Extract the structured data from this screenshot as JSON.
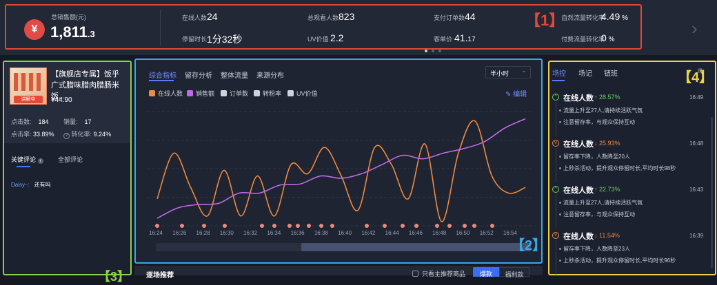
{
  "stats": {
    "sales_icon": "¥",
    "sales_label": "总销售额(元)",
    "sales_value": "1,811",
    "sales_decimal": ".3",
    "items": [
      {
        "label": "在线人数",
        "value": "24",
        "suffix": ""
      },
      {
        "label": "总观看人数",
        "value": "823",
        "suffix": ""
      },
      {
        "label": "支付订单数",
        "value": "44",
        "suffix": ""
      },
      {
        "label": "自然流量转化率",
        "value": "4.49",
        "suffix": " %"
      },
      {
        "label": "停留时长",
        "value": "1分32秒",
        "suffix": ""
      },
      {
        "label": "UV价值",
        "value": "2.2",
        "suffix": ""
      },
      {
        "label": "客单价",
        "value": "41.",
        "suffix": "17"
      },
      {
        "label": "付费流量转化率",
        "value": "0",
        "suffix": " %"
      }
    ],
    "tag": "【1】",
    "next_icon": "chevron-right-icon"
  },
  "product": {
    "title": "【旗舰店专属】饭乎广式腊味腊肉腊肠米饭...",
    "thumb_badge": "讲解中",
    "price": "¥44.90",
    "clicks_label": "点击数:",
    "clicks_value": "184",
    "sales_label": "销量:",
    "sales_value": "17",
    "ctr_label": "点击率:",
    "ctr_value": "33.89%",
    "cvr_label": "转化率:",
    "cvr_value": "9.24%",
    "tabs": [
      "关键评论",
      "全部评论"
    ],
    "comment_user": "Daisy~:",
    "comment_text": "还有吗",
    "tag": "【3】"
  },
  "chart_panel": {
    "tabs": [
      "综合指标",
      "留存分析",
      "整体流量",
      "来源分布"
    ],
    "interval": "半小时",
    "legend": [
      {
        "name": "在线人数",
        "color": "#f08a3c"
      },
      {
        "name": "销售额",
        "color": "#c069e6"
      },
      {
        "name": "订单数",
        "color": "#cfd3da"
      },
      {
        "name": "转粉率",
        "color": "#cfd3da"
      },
      {
        "name": "UV价值",
        "color": "#cfd3da"
      }
    ],
    "edit_label": "编辑",
    "tag": "【2】",
    "bottom_title": "逐场推荐",
    "bottom_check": "只看主推荐商品",
    "bottom_btn1": "爆款",
    "bottom_btn2": "福利款"
  },
  "chart_data": {
    "type": "line",
    "x": [
      "16:24",
      "16:26",
      "16:28",
      "16:30",
      "16:32",
      "16:34",
      "16:36",
      "16:38",
      "16:40",
      "16:42",
      "16:44",
      "16:46",
      "16:48",
      "16:50",
      "16:52",
      "16:54"
    ],
    "series": [
      {
        "name": "在线人数",
        "color": "#f08a3c",
        "values": [
          2,
          6,
          3,
          0.5,
          4.5,
          0.5,
          4,
          0.5,
          5,
          4.2,
          6.5,
          4,
          1,
          6.5,
          5,
          2,
          6.8,
          0,
          6,
          8.8,
          4,
          2.5,
          3
        ]
      },
      {
        "name": "销售额",
        "color": "#c069e6",
        "values": [
          0.3,
          1.2,
          1.5,
          1.6,
          2.5,
          2.5,
          3.2,
          3.3,
          4,
          3.8,
          4.2,
          5,
          5.8,
          5.5,
          6,
          6.4,
          7,
          8.2,
          9
        ]
      }
    ],
    "markers": 20,
    "ylim": [
      0,
      10
    ],
    "grid": true
  },
  "feed": {
    "tabs": [
      "场控",
      "场记",
      "钮班"
    ],
    "tag": "【4】",
    "items": [
      {
        "title": "在线人数",
        "arrow": "↑",
        "delta": "28.57%",
        "up": true,
        "time": "16:49",
        "lines": [
          "流量上升至27人,请持续活跃气氛",
          "注意留存率，与观众保持互动"
        ]
      },
      {
        "title": "在线人数",
        "arrow": "↓",
        "delta": "25.93%",
        "up": false,
        "time": "16:48",
        "lines": [
          "留存率下降，人数降至20人",
          "上秒杀活动，提升观众停留时长,平均时长98秒"
        ]
      },
      {
        "title": "在线人数",
        "arrow": "↑",
        "delta": "22.73%",
        "up": true,
        "time": "16:43",
        "lines": [
          "流量上升至27人,请持续活跃气氛",
          "注意留存率，与观众保持互动"
        ]
      },
      {
        "title": "在线人数",
        "arrow": "↓",
        "delta": "11.54%",
        "up": false,
        "time": "16:39",
        "lines": [
          "留存率下降，人数降至23人",
          "上秒杀活动，提升观众停留时长,平均时长96秒"
        ]
      }
    ]
  }
}
